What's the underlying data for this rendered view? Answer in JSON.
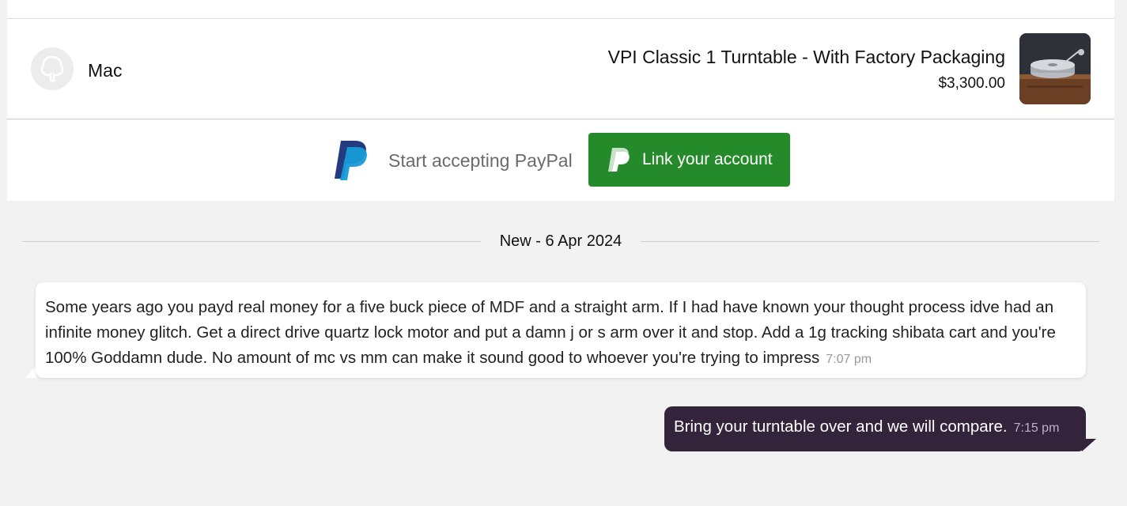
{
  "conversation": {
    "user_name": "Mac"
  },
  "listing": {
    "title": "VPI Classic 1 Turntable - With Factory Packaging",
    "price": "$3,300.00",
    "thumbnail_icon": "turntable-photo"
  },
  "paypal": {
    "prompt": "Start accepting PayPal",
    "button_label": "Link your account",
    "button_color": "#258a2a"
  },
  "date_divider": "New - 6 Apr 2024",
  "messages": [
    {
      "direction": "incoming",
      "text": "Some years ago you payd real money for a five buck piece of MDF and a straight arm.  If I had have known your thought process idve had an infinite money glitch.  Get a direct drive quartz lock motor and put a damn j or s arm over it and stop.  Add a 1g tracking shibata cart and you're 100%  Goddamn dude. No amount of mc vs mm can make it sound good to whoever you're trying to impress",
      "time": "7:07 pm"
    },
    {
      "direction": "outgoing",
      "text": "Bring your turntable over and we will compare.",
      "time": "7:15 pm"
    }
  ],
  "colors": {
    "outgoing_bubble": "#33233b",
    "incoming_bubble": "#ffffff",
    "background": "#f2f2f2"
  }
}
